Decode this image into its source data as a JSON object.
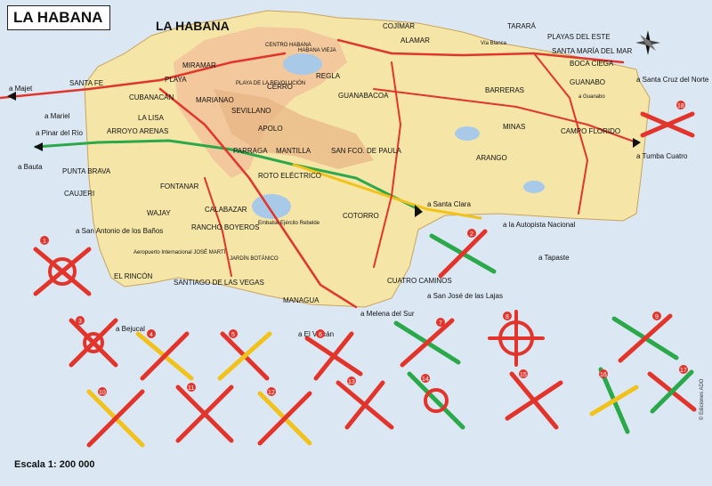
{
  "title": "LA HABANA",
  "city_label": "LA HABANA",
  "scale": "Escala 1: 200 000",
  "credit": "© Ediciones ADO",
  "colors": {
    "land": "#f5e6a8",
    "water": "#dbe8f4",
    "urban": "#f2c49a",
    "hills": "#e8b483",
    "road_main": "#e2342a",
    "road_green": "#2aa84a",
    "road_yellow": "#f2c21a",
    "lake": "#a9c9e8"
  },
  "places": [
    {
      "name": "PLAYA"
    },
    {
      "name": "MIRAMAR"
    },
    {
      "name": "CUBANACÁN"
    },
    {
      "name": "LA LISA"
    },
    {
      "name": "MARIANAO"
    },
    {
      "name": "ARROYO ARENAS"
    },
    {
      "name": "PUNTA BRAVA"
    },
    {
      "name": "SANTA FE"
    },
    {
      "name": "PLAYA DE LA REVOLUCIÓN"
    },
    {
      "name": "CERRO"
    },
    {
      "name": "REGLA"
    },
    {
      "name": "GUANABACOA"
    },
    {
      "name": "COJÍMAR"
    },
    {
      "name": "ALAMAR"
    },
    {
      "name": "TARARÁ"
    },
    {
      "name": "PLAYAS DEL ESTE"
    },
    {
      "name": "SANTA MARÍA DEL MAR"
    },
    {
      "name": "BOCA CIEGA"
    },
    {
      "name": "GUANABO"
    },
    {
      "name": "BARRERAS"
    },
    {
      "name": "MINAS"
    },
    {
      "name": "CAMPO FLORIDO"
    },
    {
      "name": "ARANGO"
    },
    {
      "name": "SEVILLANO"
    },
    {
      "name": "APOLO"
    },
    {
      "name": "MANTILLA"
    },
    {
      "name": "PARRAGA"
    },
    {
      "name": "SAN FCO. DE PAULA"
    },
    {
      "name": "ROTO ELÉCTRICO"
    },
    {
      "name": "COTORRO"
    },
    {
      "name": "FONTANAR"
    },
    {
      "name": "WAJAY"
    },
    {
      "name": "RANCHO BOYEROS"
    },
    {
      "name": "CALABAZAR"
    },
    {
      "name": "SANTIAGO DE LAS VEGAS"
    },
    {
      "name": "EL RINCÓN"
    },
    {
      "name": "MANAGUA"
    },
    {
      "name": "CUATRO CAMINOS"
    },
    {
      "name": "CAUJERI"
    },
    {
      "name": "JARDÍN BOTÁNICO"
    },
    {
      "name": "Aeropuerto Internacional JOSÉ MARTÍ"
    },
    {
      "name": "Embalse Ejército Rebelde"
    },
    {
      "name": "CENTRO HABANA"
    },
    {
      "name": "HABANA VIEJA"
    }
  ],
  "exits": [
    {
      "name": "a Mariel"
    },
    {
      "name": "a Pinar del Río"
    },
    {
      "name": "a Bauta"
    },
    {
      "name": "a San Antonio de los Baños"
    },
    {
      "name": "a Bejucal"
    },
    {
      "name": "a El Volcán"
    },
    {
      "name": "a Melena del Sur"
    },
    {
      "name": "a San José de las Lajas"
    },
    {
      "name": "a Santa Clara"
    },
    {
      "name": "a la Autopista Nacional"
    },
    {
      "name": "a Tapaste"
    },
    {
      "name": "a Santa Cruz del Norte"
    },
    {
      "name": "a Tumba Cuatro"
    },
    {
      "name": "a Majet"
    },
    {
      "name": "a Guanabo"
    },
    {
      "name": "Vía Blanca"
    }
  ],
  "interchanges": [
    {
      "num": "1"
    },
    {
      "num": "2"
    },
    {
      "num": "3"
    },
    {
      "num": "4"
    },
    {
      "num": "5"
    },
    {
      "num": "6"
    },
    {
      "num": "7"
    },
    {
      "num": "8"
    },
    {
      "num": "9"
    },
    {
      "num": "10"
    },
    {
      "num": "11"
    },
    {
      "num": "12"
    },
    {
      "num": "13"
    },
    {
      "num": "14"
    },
    {
      "num": "15"
    },
    {
      "num": "16"
    },
    {
      "num": "17"
    },
    {
      "num": "18"
    }
  ]
}
